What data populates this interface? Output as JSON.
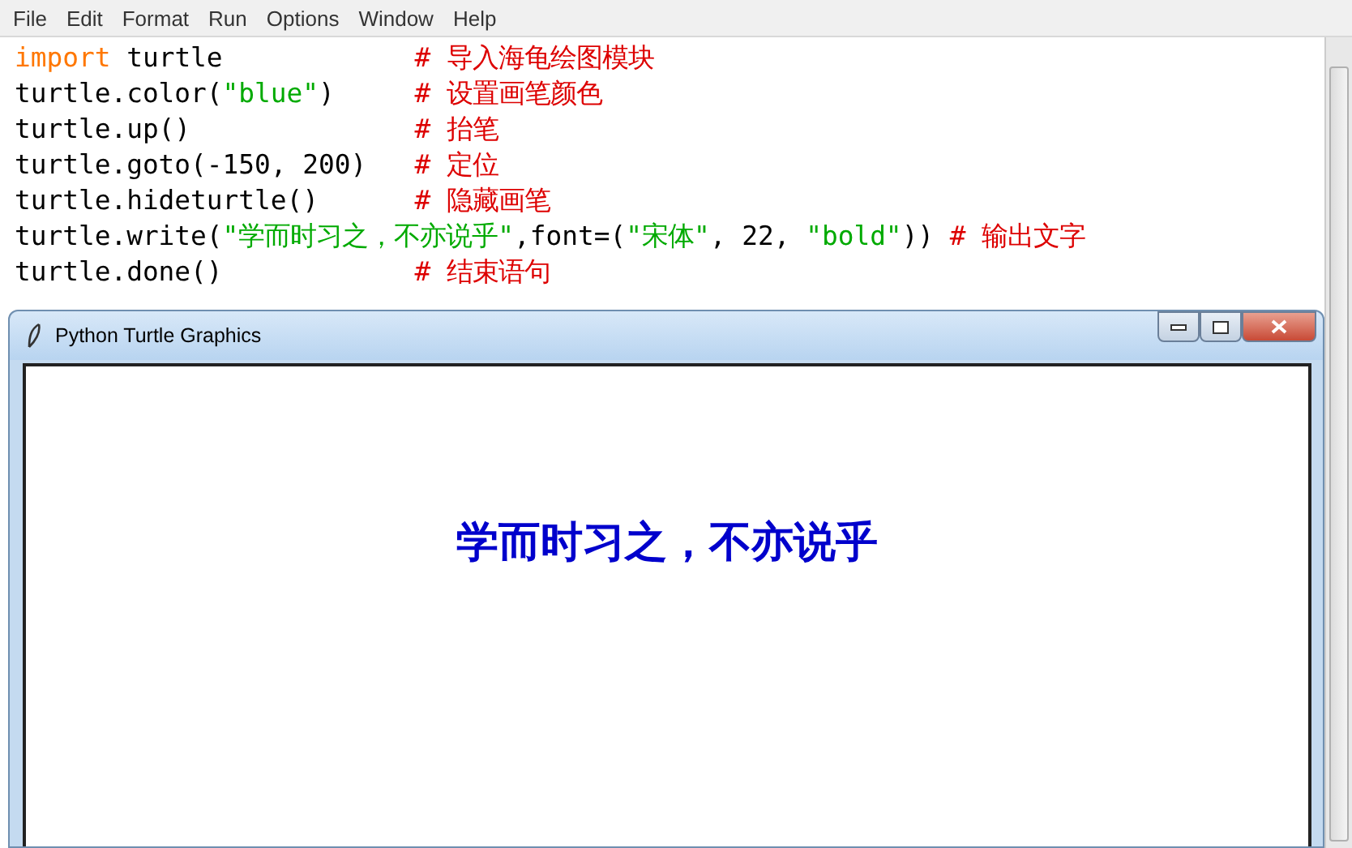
{
  "menu": [
    "File",
    "Edit",
    "Format",
    "Run",
    "Options",
    "Window",
    "Help"
  ],
  "code_lines": [
    {
      "tokens": [
        {
          "kind": "keyword",
          "text": "import"
        },
        {
          "kind": "plain",
          "text": " turtle            "
        },
        {
          "kind": "comment",
          "text": "# 导入海龟绘图模块"
        }
      ]
    },
    {
      "tokens": [
        {
          "kind": "plain",
          "text": "turtle.color("
        },
        {
          "kind": "string",
          "text": "\"blue\""
        },
        {
          "kind": "plain",
          "text": ")     "
        },
        {
          "kind": "comment",
          "text": "# 设置画笔颜色"
        }
      ]
    },
    {
      "tokens": [
        {
          "kind": "plain",
          "text": "turtle.up()              "
        },
        {
          "kind": "comment",
          "text": "# 抬笔"
        }
      ]
    },
    {
      "tokens": [
        {
          "kind": "plain",
          "text": "turtle.goto(-150, 200)   "
        },
        {
          "kind": "comment",
          "text": "# 定位"
        }
      ]
    },
    {
      "tokens": [
        {
          "kind": "plain",
          "text": "turtle.hideturtle()      "
        },
        {
          "kind": "comment",
          "text": "# 隐藏画笔"
        }
      ]
    },
    {
      "tokens": [
        {
          "kind": "plain",
          "text": "turtle.write("
        },
        {
          "kind": "string",
          "text": "\"学而时习之，不亦说乎\""
        },
        {
          "kind": "plain",
          "text": ",font=("
        },
        {
          "kind": "string",
          "text": "\"宋体\""
        },
        {
          "kind": "plain",
          "text": ", 22, "
        },
        {
          "kind": "string",
          "text": "\"bold\""
        },
        {
          "kind": "plain",
          "text": ")) "
        },
        {
          "kind": "comment",
          "text": "# 输出文字"
        }
      ]
    },
    {
      "tokens": [
        {
          "kind": "plain",
          "text": "turtle.done()            "
        },
        {
          "kind": "comment",
          "text": "# 结束语句"
        }
      ]
    }
  ],
  "turtle_window": {
    "title": "Python Turtle Graphics",
    "canvas_text": "学而时习之，不亦说乎"
  }
}
